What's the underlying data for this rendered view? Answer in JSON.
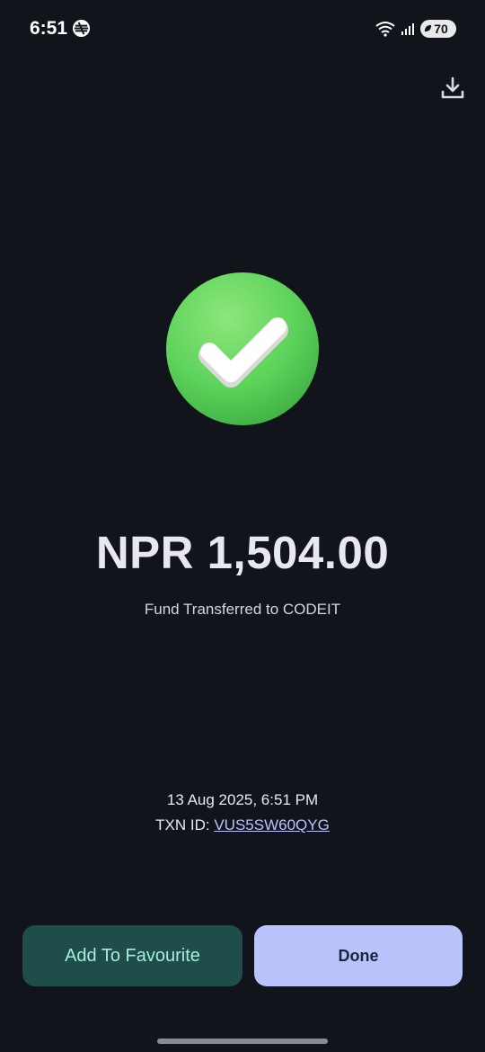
{
  "status_bar": {
    "time": "6:51",
    "battery_level": "70",
    "icons": [
      "app-notification-icon",
      "wifi-icon",
      "signal-icon",
      "battery-icon"
    ]
  },
  "header": {
    "download_icon": "download-icon"
  },
  "result": {
    "status_icon": "success-check-icon",
    "amount": "NPR 1,504.00",
    "description": "Fund Transferred to CODEIT"
  },
  "transaction": {
    "datetime": "13 Aug 2025, 6:51 PM",
    "txn_label": "TXN ID:",
    "txn_id": "VUS5SW60QYG"
  },
  "actions": {
    "add_favourite_label": "Add To Favourite",
    "done_label": "Done"
  },
  "colors": {
    "background": "#12141c",
    "success_green": "#5cd35a",
    "favourite_bg": "#1e4d4a",
    "favourite_text": "#a8ecde",
    "done_bg": "#b8c4fb",
    "link": "#b8c4fb"
  }
}
